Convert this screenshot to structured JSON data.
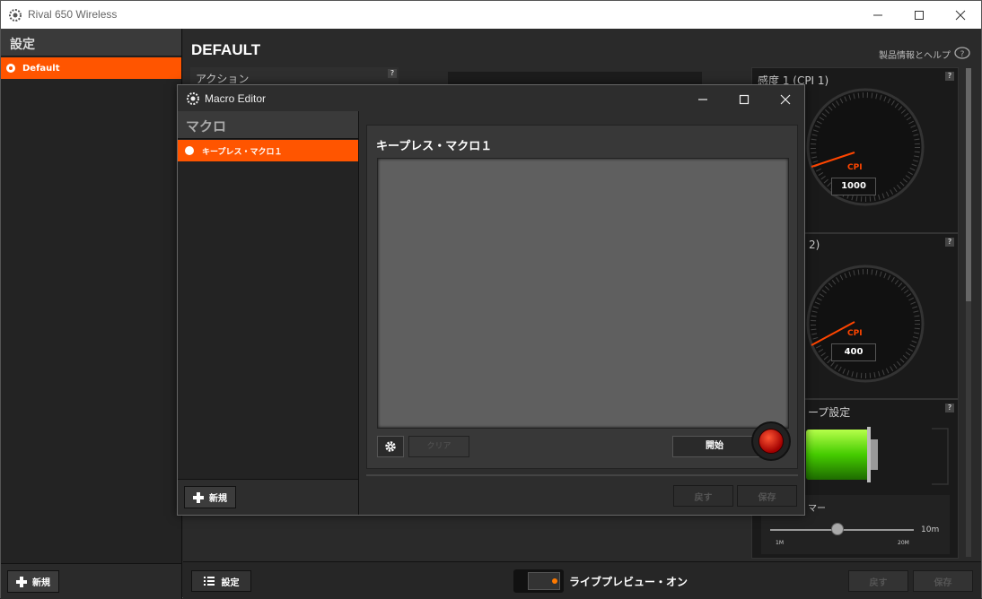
{
  "window": {
    "title": "Rival 650 Wireless",
    "controls": [
      "minimize",
      "maximize",
      "close"
    ]
  },
  "sidebar": {
    "header": "設定",
    "items": [
      {
        "label": "Default",
        "selected": true
      }
    ],
    "new_button": "新規"
  },
  "main": {
    "title": "DEFAULT",
    "help_link": "製品情報とヘルプ",
    "action_label": "アクション",
    "sensitivity1_label": "感度 1 (CPI 1)",
    "sensitivity2_label": "2)",
    "sensitivity1_cpi_label": "CPI",
    "sensitivity1_value": "1000",
    "sensitivity2_cpi_label": "CPI",
    "sensitivity2_value": "400",
    "battery_label": "ープ設定",
    "timer_label": "マー",
    "slider_min": "1M",
    "slider_max": "20M",
    "slider_value": "10m",
    "help_badge": "?",
    "settings_button": "設定",
    "live_preview": "ライブプレビュー・オン",
    "revert_button": "戻す",
    "save_button": "保存"
  },
  "macro_editor": {
    "title": "Macro Editor",
    "left_header": "マクロ",
    "macros": [
      {
        "label": "キープレス・マクロ１",
        "selected": true
      }
    ],
    "new_button": "新規",
    "macro_name": "キープレス・マクロ１",
    "clear_button": "クリア",
    "start_button": "開始",
    "revert_button": "戻す",
    "save_button": "保存"
  },
  "colors": {
    "accent": "#ff5500",
    "background": "#262626",
    "panel": "#1f1f1f"
  }
}
